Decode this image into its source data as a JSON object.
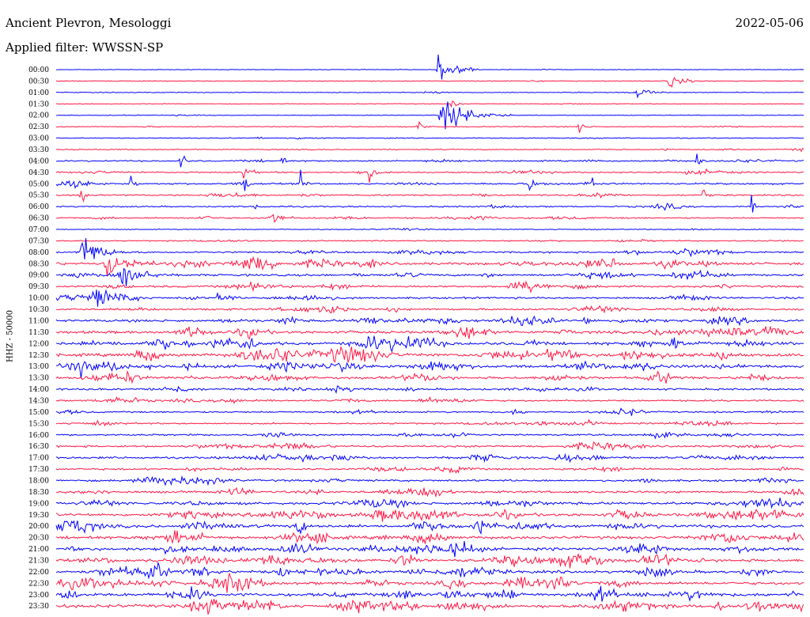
{
  "header": {
    "station": "Ancient Plevron, Mesologgi",
    "date": "2022-05-06",
    "filter_label": "Applied filter:",
    "filter_value": "WWSSN-SP"
  },
  "chart_data": {
    "type": "line",
    "title": "Ancient Plevron, Mesologgi",
    "ylabel": "HHZ - 50000",
    "xlabel": "",
    "trace_colors": [
      "#0000ff",
      "#ff1744"
    ],
    "rows": [
      {
        "label": "00:00",
        "activity": 0.05
      },
      {
        "label": "00:30",
        "activity": 0.15
      },
      {
        "label": "01:00",
        "activity": 0.12
      },
      {
        "label": "01:30",
        "activity": 0.08
      },
      {
        "label": "02:00",
        "activity": 0.08
      },
      {
        "label": "02:30",
        "activity": 0.15
      },
      {
        "label": "03:00",
        "activity": 0.15
      },
      {
        "label": "03:30",
        "activity": 0.2
      },
      {
        "label": "04:00",
        "activity": 0.35
      },
      {
        "label": "04:30",
        "activity": 0.35
      },
      {
        "label": "05:00",
        "activity": 0.45
      },
      {
        "label": "05:30",
        "activity": 0.35
      },
      {
        "label": "06:00",
        "activity": 0.35
      },
      {
        "label": "06:30",
        "activity": 0.35
      },
      {
        "label": "07:00",
        "activity": 0.15
      },
      {
        "label": "07:30",
        "activity": 0.25
      },
      {
        "label": "08:00",
        "activity": 0.45
      },
      {
        "label": "08:30",
        "activity": 0.75
      },
      {
        "label": "09:00",
        "activity": 0.6
      },
      {
        "label": "09:30",
        "activity": 0.55
      },
      {
        "label": "10:00",
        "activity": 0.5
      },
      {
        "label": "10:30",
        "activity": 0.55
      },
      {
        "label": "11:00",
        "activity": 0.7
      },
      {
        "label": "11:30",
        "activity": 0.85
      },
      {
        "label": "12:00",
        "activity": 0.95
      },
      {
        "label": "12:30",
        "activity": 0.95
      },
      {
        "label": "13:00",
        "activity": 0.9
      },
      {
        "label": "13:30",
        "activity": 0.7
      },
      {
        "label": "14:00",
        "activity": 0.55
      },
      {
        "label": "14:30",
        "activity": 0.45
      },
      {
        "label": "15:00",
        "activity": 0.4
      },
      {
        "label": "15:30",
        "activity": 0.4
      },
      {
        "label": "16:00",
        "activity": 0.45
      },
      {
        "label": "16:30",
        "activity": 0.55
      },
      {
        "label": "17:00",
        "activity": 0.6
      },
      {
        "label": "17:30",
        "activity": 0.5
      },
      {
        "label": "18:00",
        "activity": 0.55
      },
      {
        "label": "18:30",
        "activity": 0.65
      },
      {
        "label": "19:00",
        "activity": 0.8
      },
      {
        "label": "19:30",
        "activity": 0.9
      },
      {
        "label": "20:00",
        "activity": 0.95
      },
      {
        "label": "20:30",
        "activity": 0.9
      },
      {
        "label": "21:00",
        "activity": 0.95
      },
      {
        "label": "21:30",
        "activity": 0.9
      },
      {
        "label": "22:00",
        "activity": 0.85
      },
      {
        "label": "22:30",
        "activity": 0.9
      },
      {
        "label": "23:00",
        "activity": 0.95
      },
      {
        "label": "23:30",
        "activity": 1.0
      }
    ],
    "events": [
      {
        "row": 0,
        "minute": 15.3,
        "amplitude": 1.0,
        "duration": 1.6
      },
      {
        "row": 1,
        "minute": 24.6,
        "amplitude": 0.35,
        "duration": 1.2
      },
      {
        "row": 2,
        "minute": 23.3,
        "amplitude": 0.3,
        "duration": 1.0
      },
      {
        "row": 3,
        "minute": 15.9,
        "amplitude": 0.25,
        "duration": 0.5
      },
      {
        "row": 4,
        "minute": 15.4,
        "amplitude": 0.9,
        "duration": 2.8
      },
      {
        "row": 5,
        "minute": 14.5,
        "amplitude": 0.4,
        "duration": 0.6
      },
      {
        "row": 5,
        "minute": 21.0,
        "amplitude": 0.55,
        "duration": 0.4
      },
      {
        "row": 6,
        "minute": 8.0,
        "amplitude": 0.4,
        "duration": 0.3
      },
      {
        "row": 8,
        "minute": 5.0,
        "amplitude": 0.8,
        "duration": 0.3
      },
      {
        "row": 8,
        "minute": 9.0,
        "amplitude": 0.8,
        "duration": 0.3
      },
      {
        "row": 8,
        "minute": 25.7,
        "amplitude": 0.6,
        "duration": 0.3
      },
      {
        "row": 9,
        "minute": 7.5,
        "amplitude": 0.5,
        "duration": 0.6
      },
      {
        "row": 9,
        "minute": 12.5,
        "amplitude": 0.5,
        "duration": 0.6
      },
      {
        "row": 10,
        "minute": 3.0,
        "amplitude": 0.6,
        "duration": 0.3
      },
      {
        "row": 10,
        "minute": 7.5,
        "amplitude": 0.7,
        "duration": 0.4
      },
      {
        "row": 10,
        "minute": 9.8,
        "amplitude": 0.6,
        "duration": 0.4
      },
      {
        "row": 10,
        "minute": 19.0,
        "amplitude": 0.5,
        "duration": 0.3
      },
      {
        "row": 10,
        "minute": 21.5,
        "amplitude": 0.5,
        "duration": 0.4
      },
      {
        "row": 11,
        "minute": 1.0,
        "amplitude": 0.6,
        "duration": 0.3
      },
      {
        "row": 11,
        "minute": 26.0,
        "amplitude": 0.5,
        "duration": 0.3
      },
      {
        "row": 12,
        "minute": 8.0,
        "amplitude": 0.6,
        "duration": 0.3
      },
      {
        "row": 12,
        "minute": 27.9,
        "amplitude": 0.5,
        "duration": 0.3
      },
      {
        "row": 13,
        "minute": 8.5,
        "amplitude": 0.5,
        "duration": 1.0
      },
      {
        "row": 16,
        "minute": 1.0,
        "amplitude": 0.9,
        "duration": 1.8
      },
      {
        "row": 17,
        "minute": 2.0,
        "amplitude": 0.8,
        "duration": 2.0
      },
      {
        "row": 18,
        "minute": 2.5,
        "amplitude": 0.8,
        "duration": 1.6
      },
      {
        "row": 20,
        "minute": 1.5,
        "amplitude": 0.7,
        "duration": 1.2
      },
      {
        "row": 20,
        "minute": 6.5,
        "amplitude": 0.7,
        "duration": 0.8
      }
    ]
  }
}
